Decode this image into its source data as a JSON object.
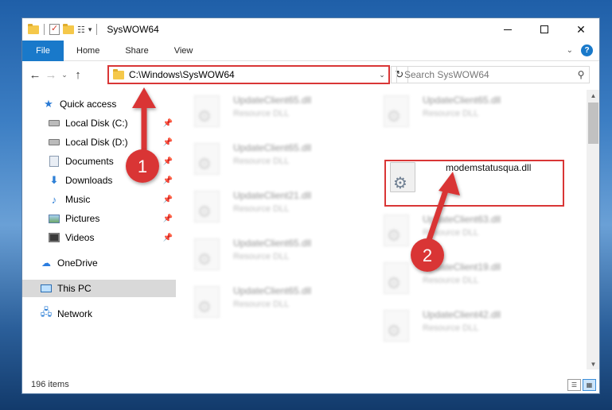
{
  "window": {
    "title": "SysWOW64",
    "controls": {
      "minimize": "—",
      "maximize": "☐",
      "close": "✕"
    }
  },
  "ribbon": {
    "tabs": [
      "File",
      "Home",
      "Share",
      "View"
    ],
    "help": "?"
  },
  "nav": {
    "address": "C:\\Windows\\SysWOW64",
    "search_placeholder": "Search SysWOW64"
  },
  "sidebar": {
    "quick_access": "Quick access",
    "items": [
      {
        "label": "Local Disk (C:)",
        "icon": "drive-icon",
        "pinned": true
      },
      {
        "label": "Local Disk (D:)",
        "icon": "drive-icon",
        "pinned": true
      },
      {
        "label": "Documents",
        "icon": "documents-icon",
        "pinned": true
      },
      {
        "label": "Downloads",
        "icon": "downloads-icon",
        "pinned": true
      },
      {
        "label": "Music",
        "icon": "music-icon",
        "pinned": true
      },
      {
        "label": "Pictures",
        "icon": "pictures-icon",
        "pinned": true
      },
      {
        "label": "Videos",
        "icon": "videos-icon",
        "pinned": true
      }
    ],
    "onedrive": "OneDrive",
    "this_pc": "This PC",
    "network": "Network"
  },
  "files": [
    {
      "name": "UpdateClient65.dll",
      "type": "Resource DLL",
      "blurred": true
    },
    {
      "name": "UpdateClient65.dll",
      "type": "Resource DLL",
      "blurred": true
    },
    {
      "name": "UpdateClient65.dll",
      "type": "Resource DLL",
      "blurred": true
    },
    {
      "name": "modemstatusqua.dll",
      "type": "",
      "blurred": false,
      "highlighted": true
    },
    {
      "name": "UpdateClient21.dll",
      "type": "Resource DLL",
      "blurred": true
    },
    {
      "name": "UpdateClient63.dll",
      "type": "Resource DLL",
      "blurred": true
    },
    {
      "name": "UpdateClient65.dll",
      "type": "Resource DLL",
      "blurred": true
    },
    {
      "name": "UpdateClient19.dll",
      "type": "Resource DLL",
      "blurred": true
    },
    {
      "name": "UpdateClient65.dll",
      "type": "Resource DLL",
      "blurred": true
    },
    {
      "name": "UpdateClient42.dll",
      "type": "Resource DLL",
      "blurred": true
    }
  ],
  "status": {
    "item_count": "196 items"
  },
  "annotations": {
    "step1": "1",
    "step2": "2",
    "color": "#d93636"
  },
  "colors": {
    "accent": "#1979ca",
    "highlight": "#d93636",
    "selected": "#d9d9d9"
  }
}
